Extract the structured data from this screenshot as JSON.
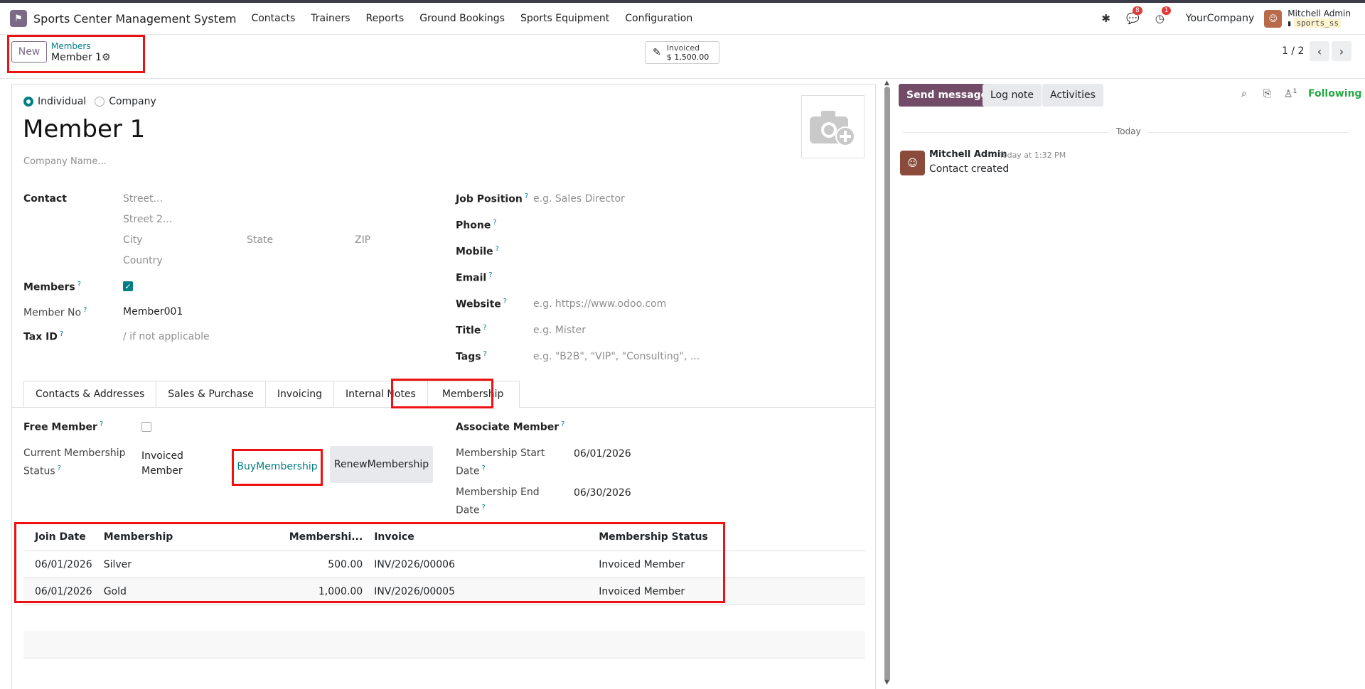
{
  "app": {
    "name": "Sports Center Management System",
    "menu": [
      "Contacts",
      "Trainers",
      "Reports",
      "Ground Bookings",
      "Sports Equipment",
      "Configuration"
    ],
    "company": "YourCompany",
    "user": {
      "name": "Mitchell Admin",
      "db": "sports_ss"
    },
    "badges": {
      "messages": "8",
      "activities": "1"
    }
  },
  "control_panel": {
    "new_label": "New",
    "breadcrumb_parent": "Members",
    "breadcrumb_current": "Member 1",
    "smart_button": {
      "label": "Invoiced",
      "value": "$ 1,500.00"
    },
    "pager": "1 / 2"
  },
  "form": {
    "radio": {
      "individual": "Individual",
      "company": "Company",
      "selected": "Individual"
    },
    "name": "Member 1",
    "company_name_placeholder": "Company Name...",
    "labels": {
      "contact": "Contact",
      "members": "Members",
      "member_no": "Member No",
      "tax_id": "Tax ID",
      "job_position": "Job Position",
      "phone": "Phone",
      "mobile": "Mobile",
      "email": "Email",
      "website": "Website",
      "title": "Title",
      "tags": "Tags"
    },
    "placeholders": {
      "street": "Street...",
      "street2": "Street 2...",
      "city": "City",
      "state": "State",
      "zip": "ZIP",
      "country": "Country",
      "tax_id": "/ if not applicable",
      "job_position": "e.g. Sales Director",
      "website": "e.g. https://www.odoo.com",
      "title": "e.g. Mister",
      "tags": "e.g. \"B2B\", \"VIP\", \"Consulting\", ..."
    },
    "members_checked": true,
    "member_no": "Member001",
    "tabs": [
      "Contacts & Addresses",
      "Sales & Purchase",
      "Invoicing",
      "Internal Notes",
      "Membership"
    ],
    "active_tab": "Membership"
  },
  "membership": {
    "labels": {
      "free_member": "Free Member",
      "status_l1": "Current Membership",
      "status_l2": "Status",
      "associate_member": "Associate Member",
      "start_l1": "Membership Start",
      "start_l2": "Date",
      "end_l1": "Membership End",
      "end_l2": "Date"
    },
    "free_member": false,
    "status_l1": "Invoiced",
    "status_l2": "Member",
    "buy_l1": "Buy",
    "buy_l2": "Membership",
    "renew_l1": "Renew",
    "renew_l2": "Membership",
    "start_date": "06/01/2026",
    "end_date": "06/30/2026",
    "table": {
      "headers": [
        "Join Date",
        "Membership",
        "Membershi...",
        "Invoice",
        "Membership Status"
      ],
      "rows": [
        [
          "06/01/2026",
          "Silver",
          "500.00",
          "INV/2026/00006",
          "Invoiced Member"
        ],
        [
          "06/01/2026",
          "Gold",
          "1,000.00",
          "INV/2026/00005",
          "Invoiced Member"
        ]
      ]
    }
  },
  "chatter": {
    "send_message": "Send message",
    "log_note": "Log note",
    "activities": "Activities",
    "followers_count": "1",
    "following": "Following",
    "today": "Today",
    "message": {
      "author": "Mitchell Admin",
      "time": "Today at 1:32 PM",
      "body": "Contact created"
    }
  }
}
